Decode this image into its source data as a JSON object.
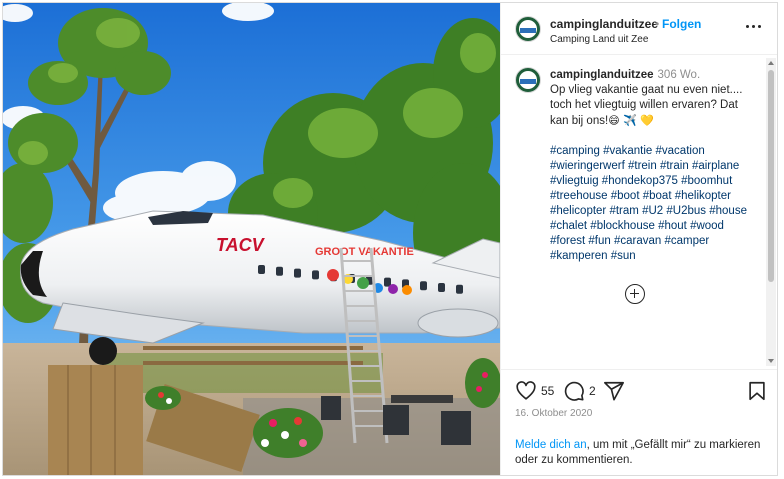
{
  "post": {
    "username": "campinglanduitzee",
    "separator": "•",
    "follow_label": "Folgen",
    "location": "Camping Land uit Zee",
    "more_icon": "more-options-icon",
    "photo_alt": "Flugzeug auf dem Campingplatz"
  },
  "caption": {
    "username": "campinglanduitzee",
    "age": "306 Wo.",
    "line1": "Op vlieg vakantie gaat nu even niet....",
    "line2": "toch het vliegtuig willen ervaren? Dat",
    "line3": "kan bij ons!",
    "emojis": "😄 ✈️ 💛",
    "hashtags": [
      "#camping",
      "#vakantie",
      "#vacation",
      "#wieringerwerf",
      "#trein",
      "#train",
      "#airplane",
      "#vliegtuig",
      "#hondekop375",
      "#boomhut",
      "#treehouse",
      "#boot",
      "#boat",
      "#helikopter",
      "#helicopter",
      "#tram",
      "#U2",
      "#U2bus",
      "#house",
      "#chalet",
      "#blockhouse",
      "#hout",
      "#wood",
      "#forest",
      "#fun",
      "#caravan",
      "#camper",
      "#kamperen",
      "#sun"
    ]
  },
  "photo_text": {
    "airline": "TACV",
    "tail_text": "GROOT VAKANTIE"
  },
  "actions": {
    "likes": "55",
    "comments": "2",
    "date": "16. Oktober 2020"
  },
  "login": {
    "link": "Melde dich an",
    "rest": ", um mit „Gefällt mir“ zu markieren oder zu kommentieren."
  },
  "colors": {
    "link_blue": "#0095f6",
    "hashtag_blue": "#00376b",
    "sky": "#2f86d9",
    "accent_red": "#c8102e"
  }
}
